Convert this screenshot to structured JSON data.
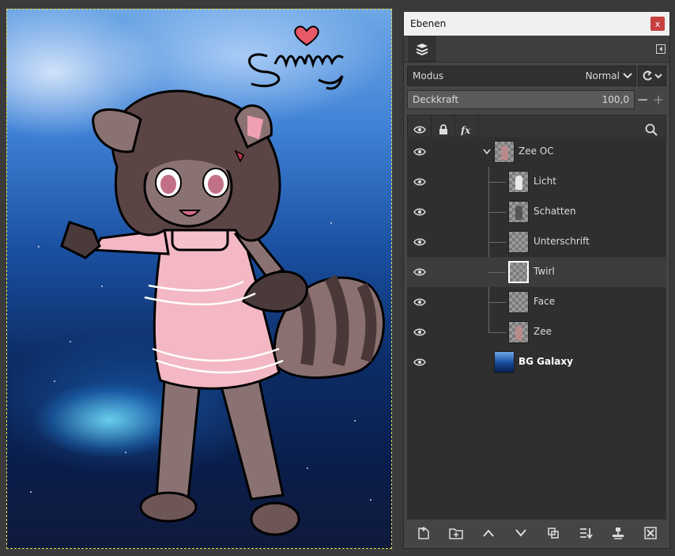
{
  "panel": {
    "title": "Ebenen",
    "close_label": "x"
  },
  "mode": {
    "label": "Modus",
    "value": "Normal"
  },
  "opacity": {
    "label": "Deckkraft",
    "value": "100,0",
    "minus": "−",
    "plus": "+"
  },
  "lock_icons": [
    "eye-icon",
    "lock-icon",
    "fx-icon"
  ],
  "layers": [
    {
      "name": "Zee OC",
      "type": "group",
      "expanded": true,
      "visible": true
    },
    {
      "name": "Licht",
      "type": "child",
      "visible": true
    },
    {
      "name": "Schatten",
      "type": "child",
      "visible": true
    },
    {
      "name": "Unterschrift",
      "type": "child",
      "visible": true
    },
    {
      "name": "Twirl",
      "type": "child",
      "visible": true,
      "selected": true
    },
    {
      "name": "Face",
      "type": "child",
      "visible": true
    },
    {
      "name": "Zee",
      "type": "child",
      "visible": true
    },
    {
      "name": "BG Galaxy",
      "type": "top",
      "visible": true,
      "bold": true
    }
  ],
  "bottom_tools": [
    "new-layer-icon",
    "new-group-icon",
    "raise-layer-icon",
    "lower-layer-icon",
    "duplicate-layer-icon",
    "merge-down-icon",
    "anchor-icon",
    "delete-layer-icon"
  ],
  "colors": {
    "selection_border": "#e8e04a",
    "close_button": "#c74040"
  }
}
